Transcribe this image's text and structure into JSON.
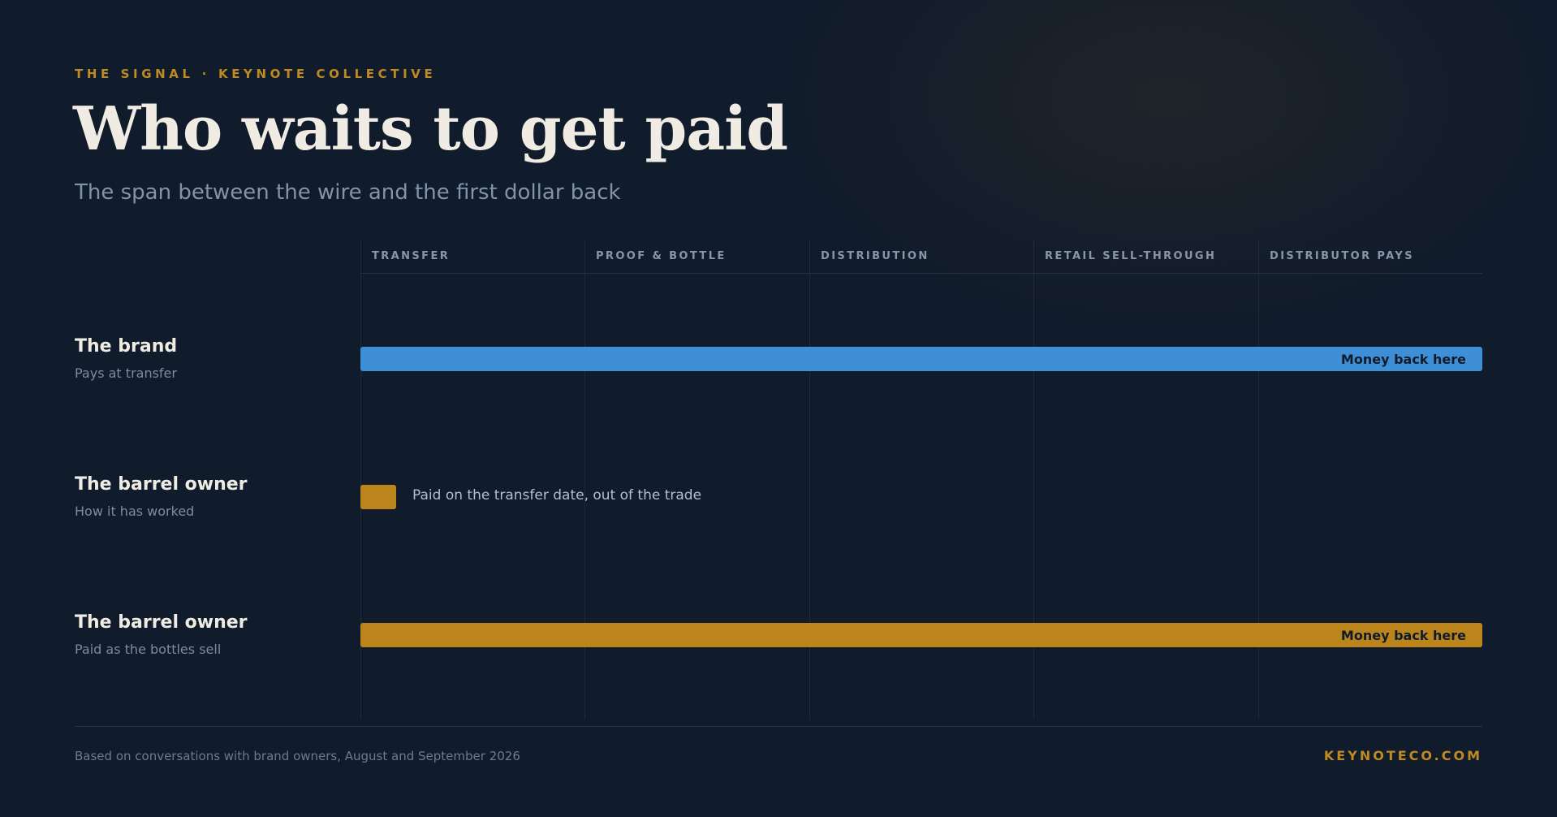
{
  "header": {
    "kicker_brand": "THE SIGNAL",
    "kicker_separator": "·",
    "kicker_org": "KEYNOTE COLLECTIVE",
    "title": "Who waits to get paid",
    "subtitle": "The span between the wire and the first dollar back"
  },
  "timeline": {
    "stages": [
      "TRANSFER",
      "PROOF & BOTTLE",
      "DISTRIBUTION",
      "RETAIL SELL-THROUGH",
      "DISTRIBUTOR PAYS"
    ],
    "rows": [
      {
        "title": "The brand",
        "subtitle": "Pays at transfer",
        "bar_label": "Money back here",
        "color": "#3e8fd6",
        "span_start_stage": 1,
        "span_end_stage": 5
      },
      {
        "title": "The barrel owner",
        "subtitle": "How it has worked",
        "note": "Paid on the transfer date, out of the trade",
        "color": "#bb851b",
        "span_start_stage": 1,
        "span_end_stage": 1
      },
      {
        "title": "The barrel owner",
        "subtitle": "Paid as the bottles sell",
        "bar_label": "Money back here",
        "color": "#bb851b",
        "span_start_stage": 1,
        "span_end_stage": 5
      }
    ]
  },
  "footer": {
    "source": "Based on conversations with brand owners, August and September 2026",
    "site": "KEYNOTECO.COM"
  },
  "colors": {
    "background": "#101b2b",
    "accent_gold": "#c08a22",
    "brand_blue": "#3e8fd6",
    "owner_gold": "#bb851b"
  }
}
